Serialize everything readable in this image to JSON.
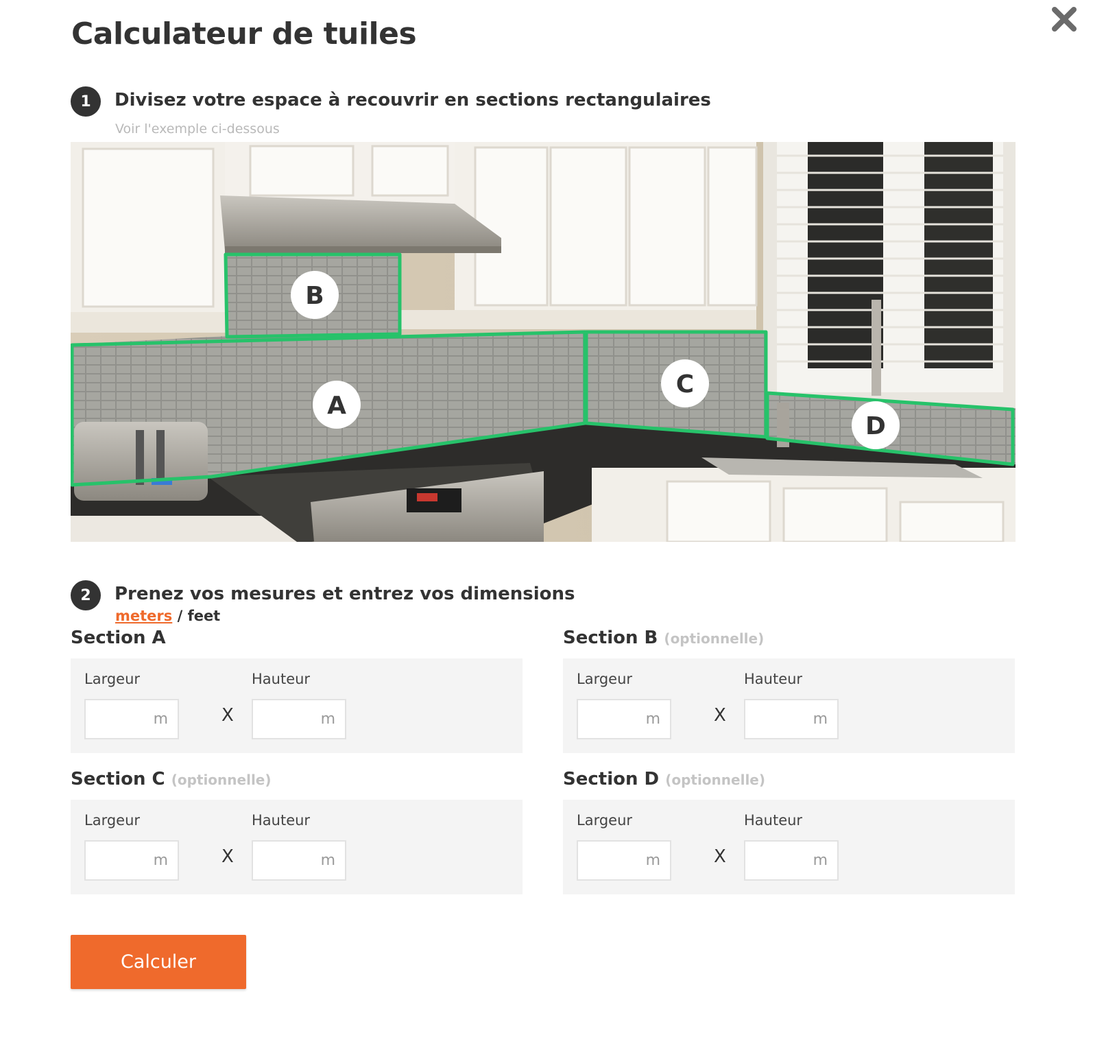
{
  "page": {
    "title": "Calculateur de tuiles"
  },
  "close": {
    "icon": "close-icon"
  },
  "step1": {
    "number": "1",
    "title": "Divisez votre espace à recouvrir en sections rectangulaires",
    "subtitle": "Voir l'exemple ci-dessous",
    "markers": [
      "A",
      "B",
      "C",
      "D"
    ]
  },
  "step2": {
    "number": "2",
    "title": "Prenez vos mesures et entrez vos dimensions",
    "units": {
      "active": "meters",
      "separator": "/",
      "other": "feet"
    }
  },
  "sections": [
    {
      "name": "Section A",
      "optional_label": "",
      "width_label": "Largeur",
      "height_label": "Hauteur",
      "width_value": "",
      "height_value": "",
      "unit": "m",
      "times": "X"
    },
    {
      "name": "Section B",
      "optional_label": "(optionnelle)",
      "width_label": "Largeur",
      "height_label": "Hauteur",
      "width_value": "",
      "height_value": "",
      "unit": "m",
      "times": "X"
    },
    {
      "name": "Section C",
      "optional_label": "(optionnelle)",
      "width_label": "Largeur",
      "height_label": "Hauteur",
      "width_value": "",
      "height_value": "",
      "unit": "m",
      "times": "X"
    },
    {
      "name": "Section D",
      "optional_label": "(optionnelle)",
      "width_label": "Largeur",
      "height_label": "Hauteur",
      "width_value": "",
      "height_value": "",
      "unit": "m",
      "times": "X"
    }
  ],
  "actions": {
    "calculate": "Calculer"
  },
  "colors": {
    "accent": "#ef6a2c",
    "outline": "#27c26a",
    "text": "#333333"
  }
}
